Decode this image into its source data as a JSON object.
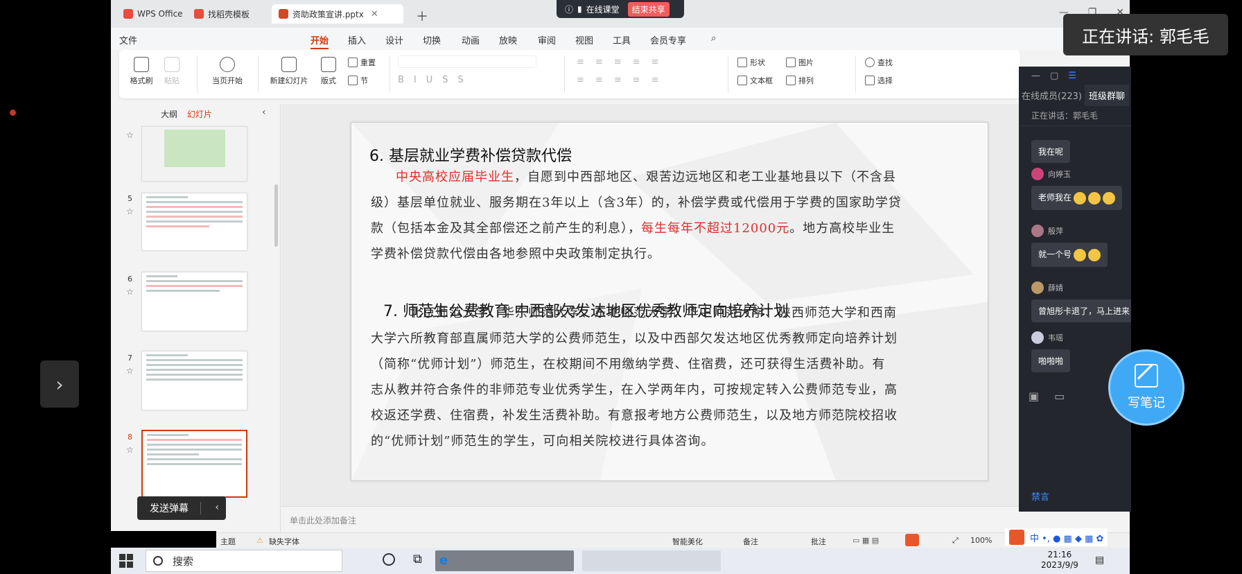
{
  "screen": {
    "tabs": [
      {
        "label": "WPS Office",
        "color": "#e84d3d"
      },
      {
        "label": "找稻壳模板",
        "color": "#e84d3d"
      },
      {
        "label": "资助政策宣讲.pptx",
        "color": "#d24726"
      }
    ]
  },
  "class_pill": {
    "label": "在线课堂",
    "end_label": "结束共享"
  },
  "speaking_banner": "正在讲话: 郭毛毛",
  "menus": [
    "文件",
    "开始",
    "插入",
    "设计",
    "切换",
    "动画",
    "放映",
    "审阅",
    "视图",
    "工具",
    "会员专享"
  ],
  "active_menu": "开始",
  "ribbon": {
    "format_painter": "格式刷",
    "paste": "粘贴",
    "play_from_current": "当页开始",
    "new_slide": "新建幻灯片",
    "layout": "版式",
    "section": "节",
    "reset": "重置",
    "shape": "形状",
    "picture": "图片",
    "textbox": "文本框",
    "arrange": "排列",
    "find": "查找",
    "select": "选择"
  },
  "left_panel": {
    "outline_tab": "大纲",
    "slides_tab": "幻灯片",
    "slide_numbers": [
      "5",
      "6",
      "7",
      "8"
    ]
  },
  "danmaku_label": "发送弹幕",
  "slide": {
    "heading1": "6. 基层就业学费补偿贷款代偿",
    "p1_red1": "中央高校应届毕业生",
    "p1_a": "，自愿到中西部地区、艰苦边远地区和老工业基地县以下（不含县",
    "p1_b": "级）基层单位就业、服务期在3年以上（含3年）的，补偿学费或代偿用于学费的国家助学贷",
    "p1_c": "款（包括本金及其全部偿还之前产生的利息），",
    "p1_red2": "每生每年不超过12000元",
    "p1_d": "。地方高校毕业生",
    "p1_e": "学费补偿贷款代偿由各地参照中央政策制定执行。",
    "heading2": "7. 师范生公费教育  中西部欠发达地区优秀教师定向培养计划",
    "p2_a": "北京师范大学、华东师范大学、东北师范大学、华中师范大学、陕西师范大学和西南",
    "p2_b": "大学六所教育部直属师范大学的公费师范生，以及中西部欠发达地区优秀教师定向培养计划",
    "p2_c": "（简称“优师计划”）师范生，在校期间不用缴纳学费、住宿费，还可获得生活费补助。有",
    "p2_d": "志从教并符合条件的非师范专业优秀学生，在入学两年内，可按规定转入公费师范专业，高",
    "p2_e": "校返还学费、住宿费，补发生活费补助。有意报考地方公费师范生，以及地方师范院校招收",
    "p2_f": "的“优师计划”师范生的学生，可向相关院校进行具体咨询。"
  },
  "notes_placeholder": "单击此处添加备注",
  "status": {
    "theme": "主题",
    "missing_font": "缺失字体",
    "smart_beautify": "智能美化",
    "notes": "备注",
    "comments": "批注",
    "zoom": "100%"
  },
  "chat": {
    "online_members": "在线成员(223)",
    "class_group": "班级群聊",
    "speaking": "正在讲话：郭毛毛",
    "messages": [
      {
        "name": "",
        "text": "我在呢"
      },
      {
        "name": "向婷玉",
        "text": "老师我在"
      },
      {
        "name": "殷萍",
        "text": "就一个号"
      },
      {
        "name": "薛婧",
        "text": "曾旭彤卡退了，马上进来"
      },
      {
        "name": "韦瑶",
        "text": "啪啪啪"
      }
    ],
    "mute": "禁言"
  },
  "write_notes": "写笔记",
  "taskbar": {
    "search": "搜索",
    "time": "21:16",
    "date": "2023/9/9"
  }
}
